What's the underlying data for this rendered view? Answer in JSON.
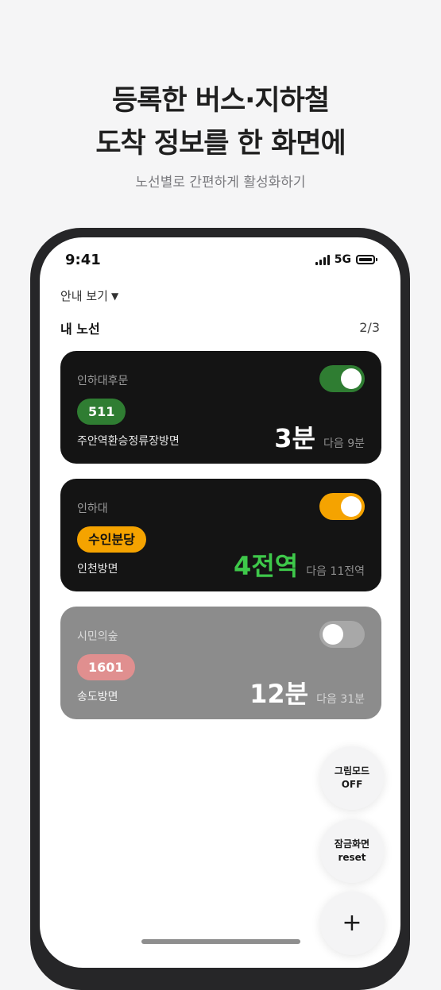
{
  "headline": {
    "line1": "등록한 버스·지하철",
    "line2": "도착 정보를 한 화면에"
  },
  "subheadline": "노선별로 간편하게 활성화하기",
  "status_bar": {
    "time": "9:41",
    "network": "5G"
  },
  "guide_label": "안내 보기",
  "routes_section": {
    "title": "내 노선",
    "count": "2/3"
  },
  "routes": [
    {
      "stop": "인하대후문",
      "badge": "511",
      "direction": "주안역환승정류장방면",
      "arrival": "3분",
      "next": "다음 9분",
      "enabled": true,
      "badge_color": "#2f7d32",
      "badge_text_color": "#ffffff",
      "arrival_color": "#ffffff",
      "toggle_color": "#2f7d32"
    },
    {
      "stop": "인하대",
      "badge": "수인분당",
      "direction": "인천방면",
      "arrival": "4전역",
      "next": "다음 11전역",
      "enabled": true,
      "badge_color": "#f5a300",
      "badge_text_color": "#111111",
      "arrival_color": "#3ec84a",
      "toggle_color": "#f5a300"
    },
    {
      "stop": "시민의숲",
      "badge": "1601",
      "direction": "송도방면",
      "arrival": "12분",
      "next": "다음 31분",
      "enabled": false,
      "badge_color": "#e08f8f",
      "badge_text_color": "#ffffff",
      "arrival_color": "#ffffff",
      "toggle_color": "#a8a8a8"
    }
  ],
  "fabs": {
    "picture_mode": {
      "line1": "그림모드",
      "line2": "OFF"
    },
    "lock_screen": {
      "line1": "잠금화면",
      "line2": "reset"
    },
    "add": "+"
  }
}
